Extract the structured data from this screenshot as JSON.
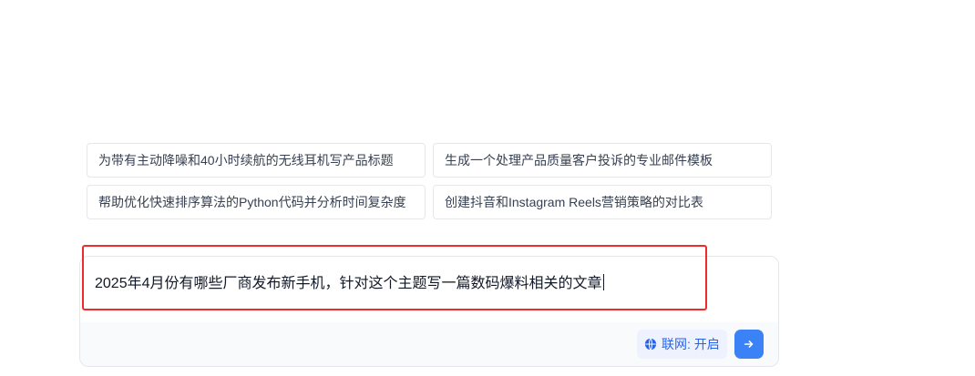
{
  "suggestions": [
    {
      "label": "为带有主动降噪和40小时续航的无线耳机写产品标题"
    },
    {
      "label": "生成一个处理产品质量客户投诉的专业邮件模板"
    },
    {
      "label": "帮助优化快速排序算法的Python代码并分析时间复杂度"
    },
    {
      "label": "创建抖音和Instagram Reels营销策略的对比表"
    }
  ],
  "composer": {
    "value": "2025年4月份有哪些厂商发布新手机，针对这个主题写一篇数码爆料相关的文章",
    "web_search_label": "联网: 开启",
    "web_search_icon": "globe-icon",
    "send_icon": "arrow-right-icon"
  },
  "colors": {
    "accent": "#3b82f6",
    "highlight": "#ef2b2b",
    "toggle_text": "#2563eb"
  }
}
